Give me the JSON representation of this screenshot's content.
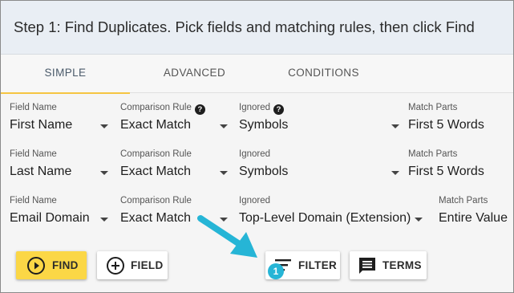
{
  "header": {
    "title": "Step 1: Find Duplicates. Pick fields and matching rules, then click Find"
  },
  "tabs": [
    {
      "label": "SIMPLE",
      "active": true
    },
    {
      "label": "ADVANCED",
      "active": false
    },
    {
      "label": "CONDITIONS",
      "active": false
    }
  ],
  "rules": [
    {
      "field_name_label": "Field Name",
      "field_name": "First Name",
      "comparison_label": "Comparison Rule",
      "comparison": "Exact Match",
      "ignored_label": "Ignored",
      "ignored": "Symbols",
      "match_parts_label": "Match Parts",
      "match_parts": "First 5 Words"
    },
    {
      "field_name_label": "Field Name",
      "field_name": "Last Name",
      "comparison_label": "Comparison Rule",
      "comparison": "Exact Match",
      "ignored_label": "Ignored",
      "ignored": "Symbols",
      "match_parts_label": "Match Parts",
      "match_parts": "First 5 Words"
    },
    {
      "field_name_label": "Field Name",
      "field_name": "Email Domain",
      "comparison_label": "Comparison Rule",
      "comparison": "Exact Match",
      "ignored_label": "Ignored",
      "ignored": "Top-Level Domain (Extension)",
      "match_parts_label": "Match Parts",
      "match_parts": "Entire Value"
    }
  ],
  "help_icon_glyph": "?",
  "buttons": {
    "find": "FIND",
    "field": "FIELD",
    "filter": "FILTER",
    "terms": "TERMS"
  },
  "filter_badge": "1",
  "icons": {
    "find": "play-circle-icon",
    "field": "add-circle-icon",
    "filter": "filter-list-icon",
    "terms": "comment-icon",
    "annotation": "arrow-icon"
  },
  "colors": {
    "primary_button": "#fbd746",
    "active_tab_underline": "#f5c542",
    "annotation_arrow": "#26b5d6",
    "header_bg": "#e9eef4"
  }
}
